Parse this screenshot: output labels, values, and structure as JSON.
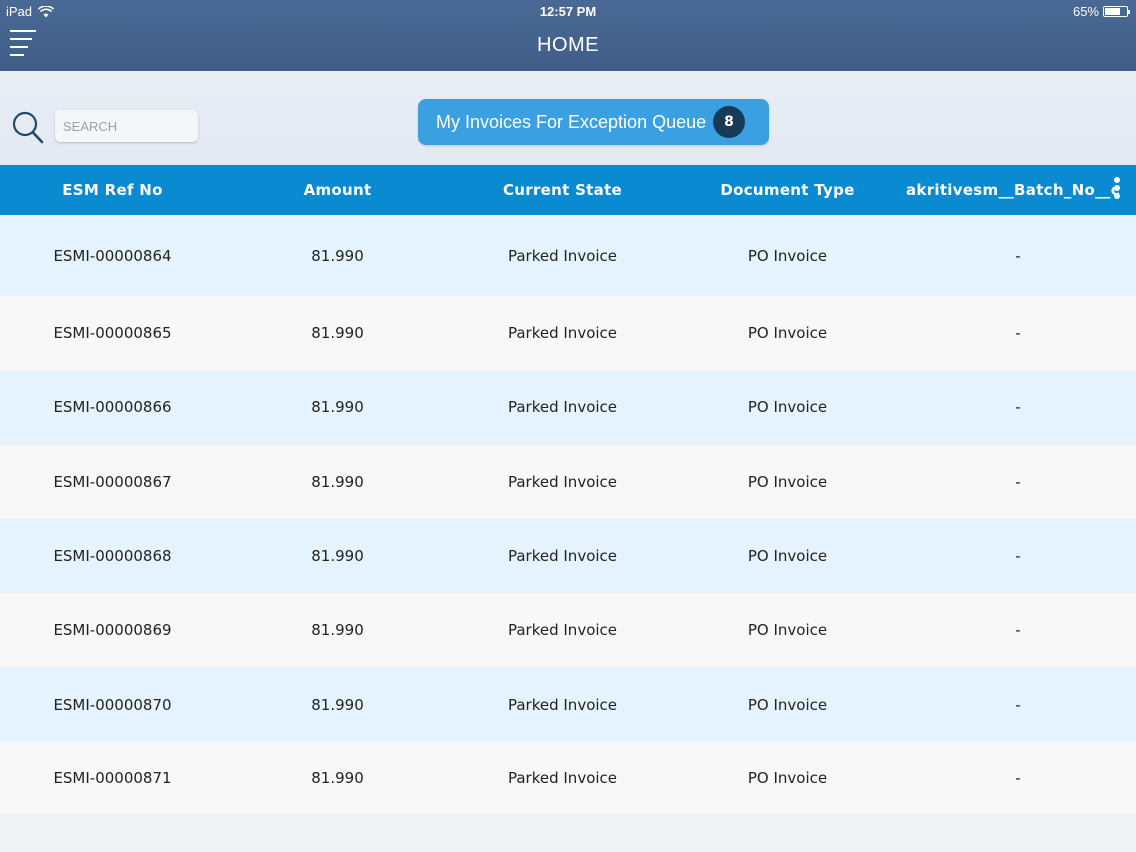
{
  "status_bar": {
    "device": "iPad",
    "time": "12:57 PM",
    "battery": "65%",
    "battery_level": 0.65
  },
  "header": {
    "title": "HOME",
    "menu_icon": "hamburger-menu-icon"
  },
  "toolbar": {
    "search_icon": "search-icon",
    "search_placeholder": "SEARCH",
    "queue_button_label": "My Invoices For Exception Queue",
    "queue_count": "8"
  },
  "table": {
    "columns": [
      "ESM Ref No",
      "Amount",
      "Current State",
      "Document Type",
      "akritivesm__Batch_No__c"
    ],
    "more_icon": "more-vertical-icon",
    "rows": [
      {
        "ref": "ESMI-00000864",
        "amount": "81.990",
        "state": "Parked Invoice",
        "doc_type": "PO Invoice",
        "batch": "-"
      },
      {
        "ref": "ESMI-00000865",
        "amount": "81.990",
        "state": "Parked Invoice",
        "doc_type": "PO Invoice",
        "batch": "-"
      },
      {
        "ref": "ESMI-00000866",
        "amount": "81.990",
        "state": "Parked Invoice",
        "doc_type": "PO Invoice",
        "batch": "-"
      },
      {
        "ref": "ESMI-00000867",
        "amount": "81.990",
        "state": "Parked Invoice",
        "doc_type": "PO Invoice",
        "batch": "-"
      },
      {
        "ref": "ESMI-00000868",
        "amount": "81.990",
        "state": "Parked Invoice",
        "doc_type": "PO Invoice",
        "batch": "-"
      },
      {
        "ref": "ESMI-00000869",
        "amount": "81.990",
        "state": "Parked Invoice",
        "doc_type": "PO Invoice",
        "batch": "-"
      },
      {
        "ref": "ESMI-00000870",
        "amount": "81.990",
        "state": "Parked Invoice",
        "doc_type": "PO Invoice",
        "batch": "-"
      },
      {
        "ref": "ESMI-00000871",
        "amount": "81.990",
        "state": "Parked Invoice",
        "doc_type": "PO Invoice",
        "batch": "-"
      }
    ]
  },
  "colors": {
    "nav_bar": "#42618c",
    "table_header": "#0a8ad0",
    "queue_button": "#3aa0e2",
    "badge": "#173b56",
    "row_alt": "#e4f3fd"
  }
}
